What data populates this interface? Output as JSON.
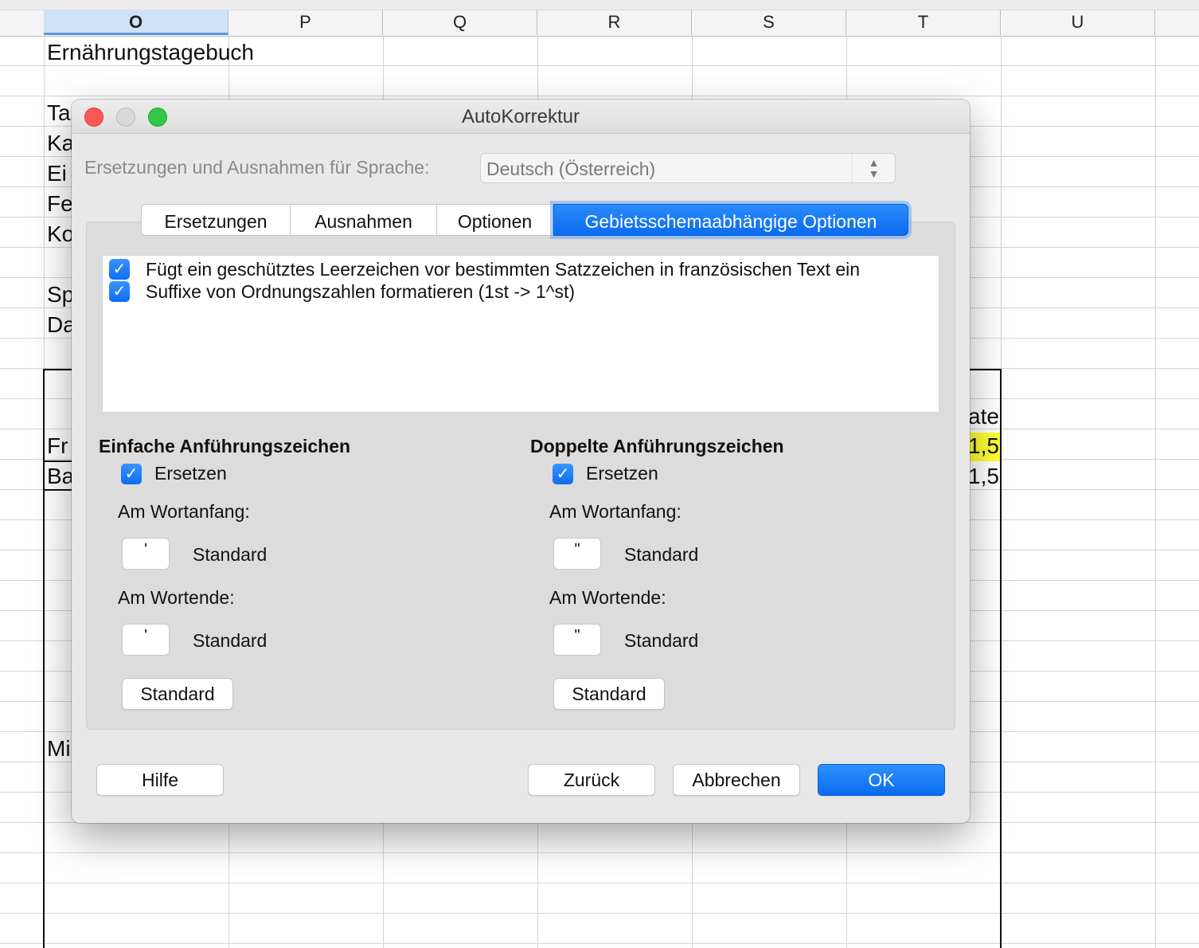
{
  "spreadsheet": {
    "columns": [
      "O",
      "P",
      "Q",
      "R",
      "S",
      "T",
      "U"
    ],
    "selected_column": "O",
    "cells": {
      "title": "Ernährungstagebuch",
      "row_ta": "Ta",
      "row_ka": "Ka",
      "row_ei": "Ei",
      "row_fe": "Fe",
      "row_ko": "Ko",
      "row_sp": "Sp",
      "row_da": "Da",
      "row_fr": "Fr",
      "row_ba": "Ba",
      "row_mi": "Mi",
      "hdr_ate": "ate",
      "val_fr": "1,5",
      "val_ba": "1,5"
    },
    "highlight_color": "#ffff33"
  },
  "dialog": {
    "title": "AutoKorrektur",
    "language_label": "Ersetzungen und Ausnahmen für Sprache:",
    "language_value": "Deutsch (Österreich)",
    "tabs": [
      {
        "label": "Ersetzungen",
        "active": false
      },
      {
        "label": "Ausnahmen",
        "active": false
      },
      {
        "label": "Optionen",
        "active": false
      },
      {
        "label": "Gebietsschemaabhängige Optionen",
        "active": true
      }
    ],
    "options": [
      {
        "label": "Fügt ein geschütztes Leerzeichen vor bestimmten Satzzeichen in französischen Text ein",
        "checked": true
      },
      {
        "label": "Suffixe von Ordnungszahlen formatieren (1st -> 1^st)",
        "checked": true
      }
    ],
    "single_quotes": {
      "title": "Einfache Anführungszeichen",
      "replace_label": "Ersetzen",
      "replace_checked": true,
      "start_label": "Am Wortanfang:",
      "start_char": "'",
      "start_value": "Standard",
      "end_label": "Am Wortende:",
      "end_char": "'",
      "end_value": "Standard",
      "default_button": "Standard"
    },
    "double_quotes": {
      "title": "Doppelte Anführungszeichen",
      "replace_label": "Ersetzen",
      "replace_checked": true,
      "start_label": "Am Wortanfang:",
      "start_char": "\"",
      "start_value": "Standard",
      "end_label": "Am Wortende:",
      "end_char": "\"",
      "end_value": "Standard",
      "default_button": "Standard"
    },
    "buttons": {
      "help": "Hilfe",
      "back": "Zurück",
      "cancel": "Abbrechen",
      "ok": "OK"
    },
    "accent_color": "#0a6cf0"
  }
}
